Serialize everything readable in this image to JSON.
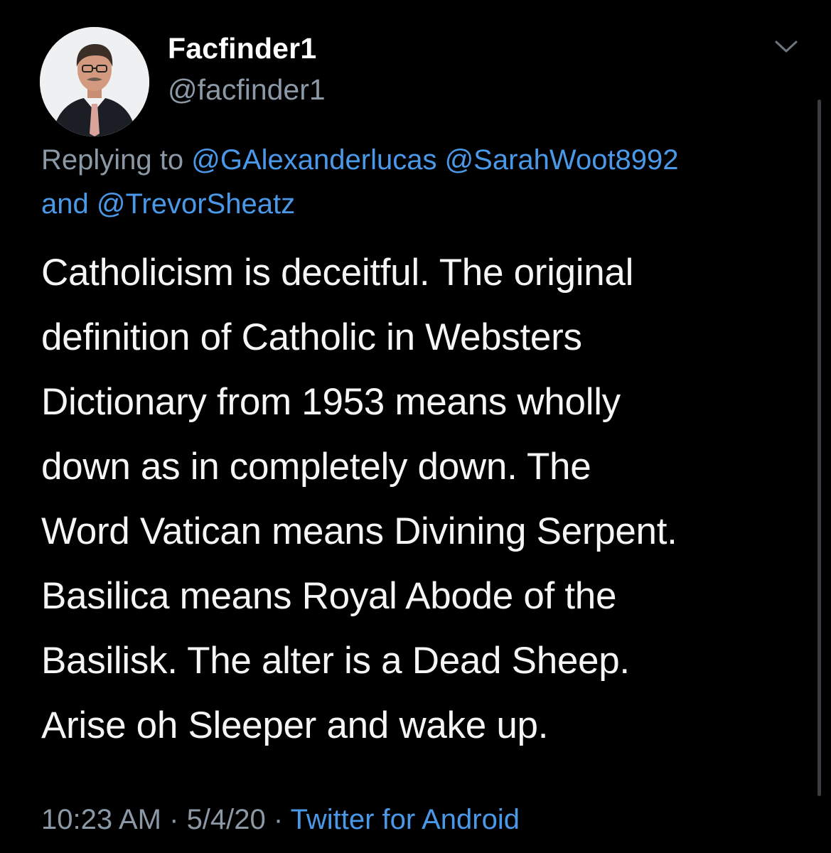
{
  "author": {
    "display_name": "Facfinder1",
    "handle": "@facfinder1",
    "avatar_icon": "avatar-photo"
  },
  "reply": {
    "prefix": "Replying to ",
    "mentions": [
      "@GAlexanderlucas",
      "@SarahWoot8992",
      "@TrevorSheatz"
    ],
    "joiner": "and "
  },
  "tweet": {
    "lines": [
      "Catholicism is deceitful. The original",
      "definition of Catholic in Websters",
      "Dictionary from 1953 means wholly",
      "down as in completely down. The",
      "Word Vatican means Divining Serpent.",
      "Basilica means Royal Abode of the",
      "Basilisk. The alter is a Dead Sheep.",
      "Arise oh Sleeper and wake up."
    ]
  },
  "meta": {
    "time": "10:23 AM",
    "separator": " · ",
    "date": "5/4/20",
    "source": "Twitter for Android"
  },
  "colors": {
    "background": "#000000",
    "text": "#f5f5f5",
    "secondary": "#8b98a5",
    "link": "#4a99e9"
  }
}
